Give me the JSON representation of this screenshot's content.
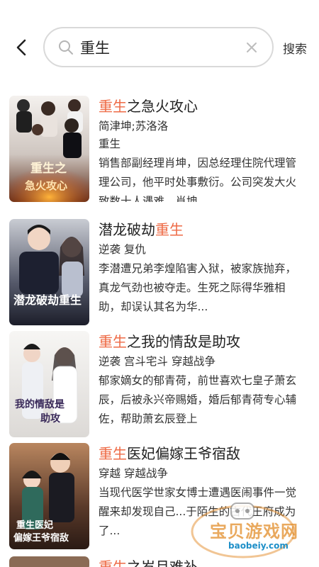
{
  "header": {
    "search_value": "重生",
    "search_button": "搜索"
  },
  "results": [
    {
      "title_parts": [
        {
          "text": "重生",
          "hl": true
        },
        {
          "text": "之急火攻心",
          "hl": false
        }
      ],
      "authors": "简津坤;苏洛洛",
      "tags": "重生",
      "tags_highlight": true,
      "description": "销售部副经理肖坤，因总经理住院代理管理公司，他平时处事敷衍。公司突发大火致数十人遇难，肖坤",
      "cover_text": "重生之急火攻心"
    },
    {
      "title_parts": [
        {
          "text": "潜龙破劫",
          "hl": false
        },
        {
          "text": "重生",
          "hl": true
        }
      ],
      "tags": "逆袭  复仇",
      "tags_highlight": false,
      "description": "李潜遭兄弟李煌陷害入狱，被家族抛弃，真龙气劲也被夺走。生死之际得华雅相助，却误认其名为华...",
      "cover_text": "潜龙破劫重生"
    },
    {
      "title_parts": [
        {
          "text": "重生",
          "hl": true
        },
        {
          "text": "之我的情敌是助攻",
          "hl": false
        }
      ],
      "tags": "逆袭  宫斗宅斗  穿越战争",
      "tags_highlight": false,
      "description": "郁家嫡女的郁青荷，前世喜欢七皇子萧玄辰，后被永兴帝赐婚，婚后郁青荷专心辅佐，帮助萧玄辰登上",
      "cover_text": "重生之我的情敌是助攻"
    },
    {
      "title_parts": [
        {
          "text": "重生",
          "hl": true
        },
        {
          "text": "医妃偏嫁王爷宿敌",
          "hl": false
        }
      ],
      "tags": "穿越  穿越战争",
      "tags_highlight": false,
      "description": "当现代医学世家女博士遭遇医闹事件一觉醒来却发现自己...于陌生的古代王府成为了...",
      "cover_text": "重生医妃偏嫁王爷宿敌"
    },
    {
      "title_parts": [
        {
          "text": "重生",
          "hl": true
        },
        {
          "text": "之岁月难补",
          "hl": false
        }
      ],
      "tags": "",
      "tags_highlight": false,
      "description": "",
      "cover_text": ""
    }
  ],
  "watermark": {
    "text": "宝贝游戏网",
    "url": "baobeiy.com"
  },
  "colors": {
    "highlight": "#ee6a45",
    "text": "#222222",
    "border": "#d9d9d9"
  }
}
